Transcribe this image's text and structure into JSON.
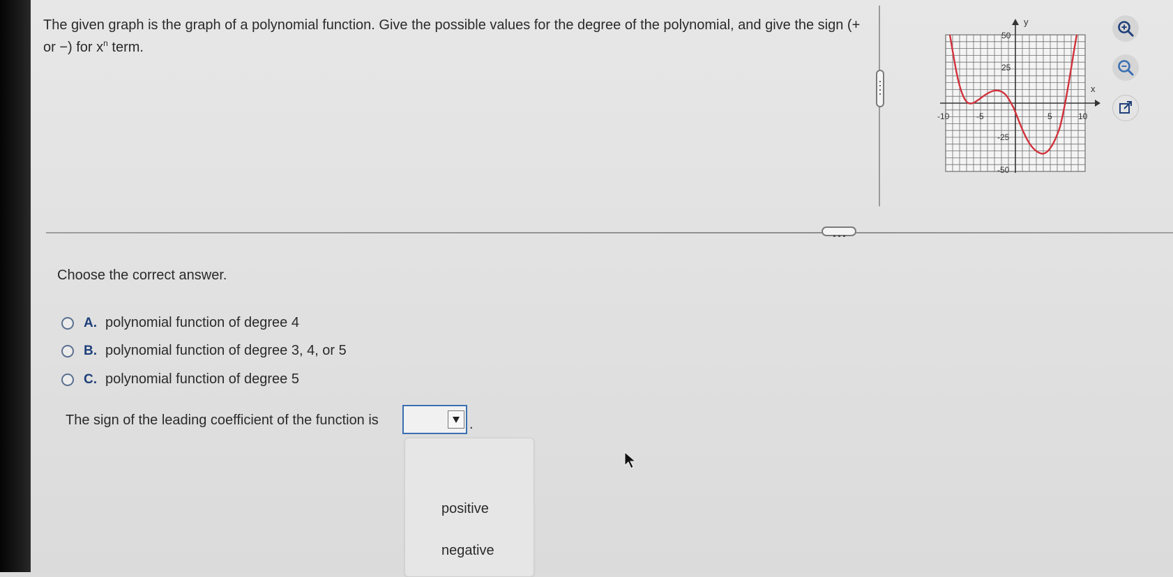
{
  "question": {
    "text_before_sup": "The given graph is the graph of a polynomial function. Give the possible values for the degree of the polynomial, and give the sign (+ or −) for x",
    "superscript": "n",
    "text_after_sup": " term."
  },
  "graph": {
    "x_axis_label": "x",
    "y_axis_label": "y",
    "x_tick_labels": [
      "-10",
      "-5",
      "5",
      "10"
    ],
    "y_tick_labels": [
      "50",
      "25",
      "-25",
      "-50"
    ],
    "curve_color": "#d1323c",
    "grid_color": "#6e6e6e"
  },
  "tools": {
    "zoom_in_icon": "zoom-in-icon",
    "zoom_out_icon": "zoom-out-icon",
    "popout_icon": "external-link-icon"
  },
  "prompt": "Choose the correct answer.",
  "options": [
    {
      "letter": "A.",
      "text": "polynomial function of degree 4"
    },
    {
      "letter": "B.",
      "text": "polynomial function of degree 3, 4, or 5"
    },
    {
      "letter": "C.",
      "text": "polynomial function of degree 5"
    }
  ],
  "sign_question": {
    "text": "The sign of the leading coefficient of the function is",
    "selected_value": "",
    "period": "."
  },
  "dropdown_options": [
    "positive",
    "negative"
  ],
  "colors": {
    "accent_blue": "#3a6fb2",
    "option_letter": "#1f3f7a"
  }
}
